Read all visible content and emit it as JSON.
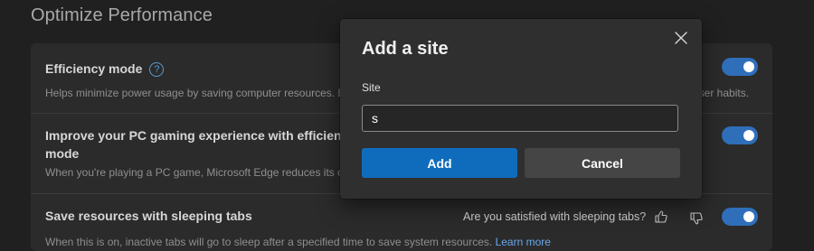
{
  "page": {
    "title": "Optimize Performance"
  },
  "settings": {
    "efficiency": {
      "title": "Efficiency mode",
      "help_glyph": "?",
      "description": "Helps minimize power usage by saving computer resources. B",
      "description_tail": "wser habits.",
      "enabled": true
    },
    "gaming": {
      "title_line1": "Improve your PC gaming experience with efficiency",
      "title_line2": "mode",
      "description": "When you're playing a PC game, Microsoft Edge reduces its co",
      "enabled": true
    },
    "sleeping_tabs": {
      "title": "Save resources with sleeping tabs",
      "survey_question": "Are you satisfied with sleeping tabs?",
      "description": "When this is on, inactive tabs will go to sleep after a specified time to save system resources.",
      "learn_more": "Learn more",
      "enabled": true
    }
  },
  "dialog": {
    "title": "Add a site",
    "field_label": "Site",
    "input_value": "s",
    "add_label": "Add",
    "cancel_label": "Cancel"
  },
  "colors": {
    "accent": "#0f6cbd",
    "toggle_on": "#2f6fba",
    "link": "#6aa8ea"
  },
  "icons": {
    "close": "close-icon",
    "help": "help-circle-icon",
    "thumbs_up": "thumbs-up-icon",
    "thumbs_down": "thumbs-down-icon"
  }
}
